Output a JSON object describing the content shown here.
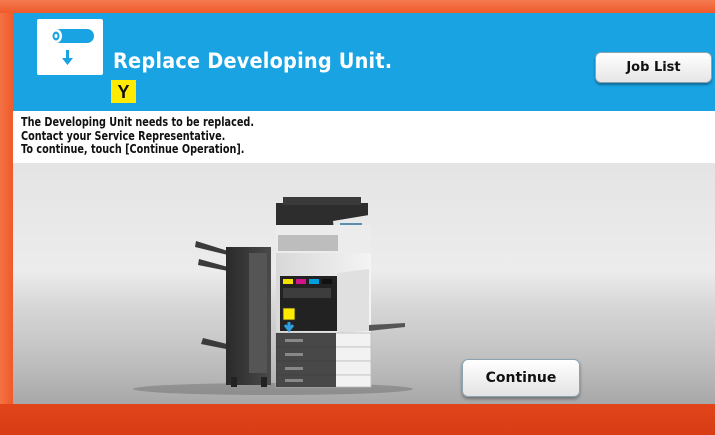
{
  "header": {
    "title": "Replace Developing Unit.",
    "icon": "developing-unit-icon",
    "color_badge": "Y",
    "background_color": "#19a3e2",
    "job_list_label": "Job List"
  },
  "message": {
    "lines": [
      "The Developing Unit needs to be replaced.",
      "Contact your Service Representative.",
      "To continue, touch [Continue Operation]."
    ]
  },
  "illustration": {
    "subject": "copier-machine-illustration",
    "highlight_color": "#ffeb00"
  },
  "actions": {
    "continue_label": "Continue"
  },
  "frame": {
    "accent_color": "#ef5a2a"
  }
}
